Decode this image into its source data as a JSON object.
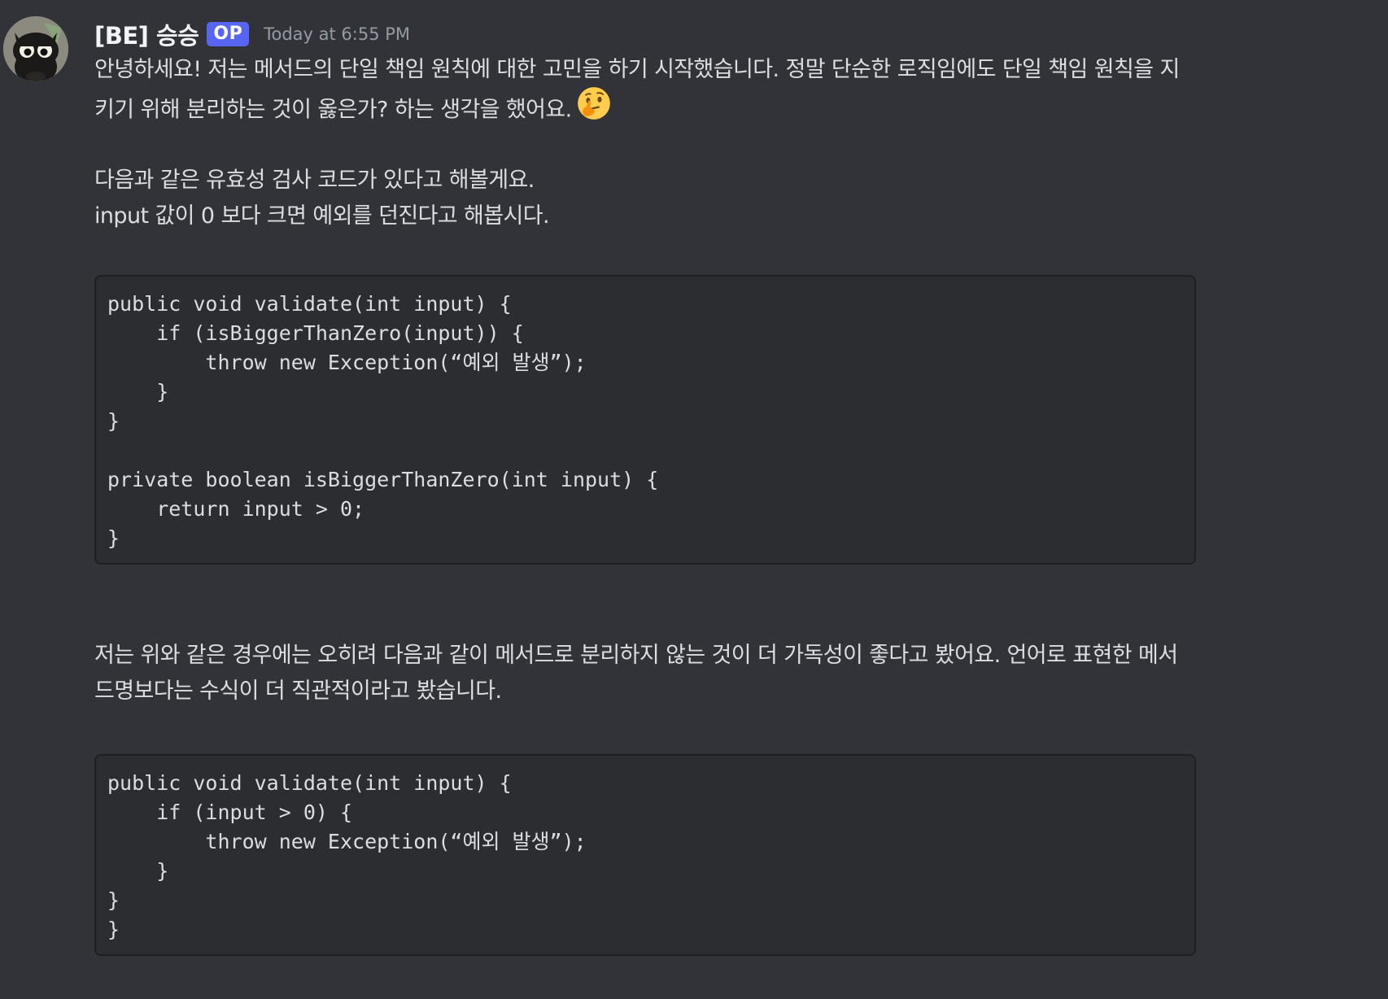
{
  "message": {
    "author": "[BE] 승승",
    "badge": "OP",
    "timestamp": "Today at 6:55 PM",
    "intro_line1": "안녕하세요! 저는 메서드의 단일 책임 원칙에 대한 고민을 하기 시작했습니다. 정말 단순한 로직임에도 단일 책임 원칙을 지",
    "intro_line2": "키기 위해 분리하는 것이 옳은가? 하는 생각을 했어요.",
    "intro_emoji": "thinking-face-icon",
    "example_line1": "다음과 같은 유효성 검사 코드가 있다고 해볼게요.",
    "example_line2": "input 값이 0 보다 크면 예외를 던진다고 해봅시다.",
    "code1": "public void validate(int input) {\n    if (isBiggerThanZero(input)) {\n        throw new Exception(“예외 발생”);\n    }\n}\n\nprivate boolean isBiggerThanZero(int input) {\n    return input > 0;\n}",
    "opinion_line1": "저는 위와 같은 경우에는 오히려 다음과 같이 메서드로 분리하지 않는 것이 더 가독성이 좋다고 봤어요. 언어로 표현한 메서",
    "opinion_line2": "드명보다는 수식이 더 직관적이라고 봤습니다.",
    "code2": "public void validate(int input) {\n    if (input > 0) {\n        throw new Exception(“예외 발생”);\n    }\n}\n}"
  },
  "colors": {
    "background": "#313338",
    "code_background": "#2b2d31",
    "badge": "#5865f2",
    "username": "#f2f3f5",
    "timestamp": "#949ba4",
    "text": "#dbdee1"
  }
}
